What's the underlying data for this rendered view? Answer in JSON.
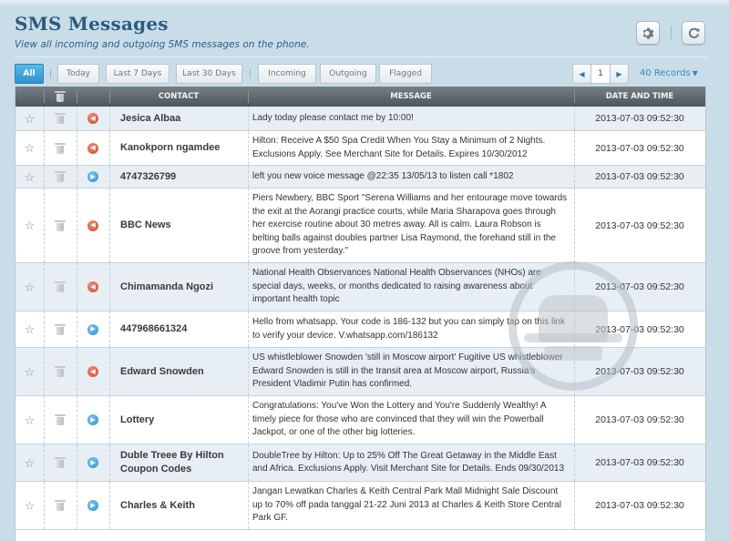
{
  "header": {
    "title": "SMS Messages",
    "subtitle": "View all incoming and outgoing SMS messages on the phone."
  },
  "toolbar": {
    "filters": {
      "all": "All",
      "today": "Today",
      "last7": "Last 7 Days",
      "last30": "Last 30 Days",
      "incoming": "Incoming",
      "outgoing": "Outgoing",
      "flagged": "Flagged"
    },
    "active_filter": "All",
    "page": "1",
    "records": "40 Records"
  },
  "table": {
    "columns": {
      "contact": "CONTACT",
      "message": "MESSAGE",
      "date": "DATE AND TIME"
    },
    "rows": [
      {
        "contact": "Jesica Albaa",
        "direction": "outgoing",
        "message": "Lady today please contact me by 10:00!",
        "date": "2013-07-03 09:52:30"
      },
      {
        "contact": "Kanokporn ngamdee",
        "direction": "outgoing",
        "message": "Hilton: Receive A $50 Spa Credit When You Stay a Minimum of 2 Nights. Exclusions Apply. See Merchant Site for Details. Expires 10/30/2012",
        "date": "2013-07-03 09:52:30"
      },
      {
        "contact": "4747326799",
        "direction": "incoming",
        "message": "left you new voice message @22:35 13/05/13 to listen call *1802",
        "date": "2013-07-03 09:52:30"
      },
      {
        "contact": "BBC News",
        "direction": "outgoing",
        "message": "Piers Newbery, BBC Sport \"Serena Williams and her entourage move towards the exit at the Aorangi practice courts, while Maria Sharapova goes through her exercise routine about 30 metres away. All is calm. Laura Robson is belting balls against doubles partner Lisa Raymond, the forehand still in the groove from yesterday.\"",
        "date": "2013-07-03 09:52:30"
      },
      {
        "contact": "Chimamanda Ngozi",
        "direction": "outgoing",
        "message": "National Health Observances National Health Observances (NHOs) are special days, weeks, or months dedicated to raising awareness about important health topic",
        "date": "2013-07-03 09:52:30"
      },
      {
        "contact": "447968661324",
        "direction": "incoming",
        "message": "Hello from whatsapp. Your code is 186-132 but you can simply tap on this link to verify your device. V.whatsapp.com/186132",
        "date": "2013-07-03 09:52:30"
      },
      {
        "contact": "Edward Snowden",
        "direction": "outgoing",
        "message": "US whistleblower Snowden 'still in Moscow airport' Fugitive US whistleblower Edward Snowden is still in the transit area at Moscow airport, Russia's President Vladimir Putin has confirmed.",
        "date": "2013-07-03 09:52:30"
      },
      {
        "contact": "Lottery",
        "direction": "incoming",
        "message": "Congratulations: You've Won the Lottery and You're Suddenly Wealthy! A timely piece for those who are convinced that they will win the Powerball Jackpot, or one of the other big lotteries.",
        "date": "2013-07-03 09:52:30"
      },
      {
        "contact": "Duble Treee By Hilton Coupon Codes",
        "direction": "incoming",
        "message": "DoubleTree by Hilton: Up to 25% Off The Great Getaway in the Middle East and Africa. Exclusions Apply. Visit Merchant Site for Details. Ends 09/30/2013",
        "date": "2013-07-03 09:52:30"
      },
      {
        "contact": "Charles & Keith",
        "direction": "incoming",
        "message": "Jangan Lewatkan Charles & Keith Central Park Mall Midnight Sale Discount up to 70% off pada tanggal 21-22 Juni 2013 at Charles & Keith Store Central Park GF.",
        "date": "2013-07-03 09:52:30"
      }
    ]
  },
  "colors": {
    "background": "#c9dde9",
    "title": "#2b5b80",
    "accent": "#2f93d1",
    "outgoing": "#d3462e",
    "incoming": "#2b8fcf"
  },
  "icons": {
    "settings": "gear-icon",
    "refresh": "refresh-icon",
    "star": "star-icon",
    "trash": "trash-icon",
    "outgoing": "arrow-left-icon",
    "incoming": "arrow-right-icon"
  }
}
